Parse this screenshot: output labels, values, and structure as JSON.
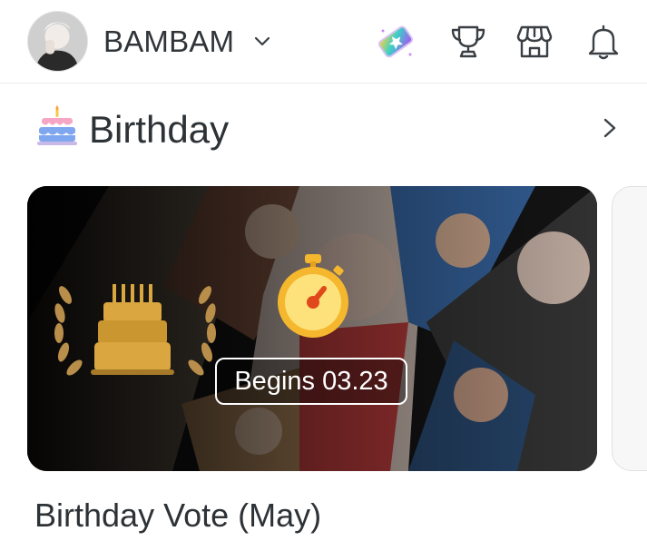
{
  "header": {
    "username": "BAMBAM",
    "icons": [
      "star-ticket-icon",
      "trophy-icon",
      "store-icon",
      "bell-icon"
    ]
  },
  "section": {
    "title": "Birthday",
    "icon": "birthday-cake-icon"
  },
  "card": {
    "badge": "Begins 03.23",
    "title": "Birthday Vote (May)"
  },
  "colors": {
    "text": "#2f3437",
    "accent_gold": "#f5b72e",
    "card_bg": "#0d0d0d"
  }
}
